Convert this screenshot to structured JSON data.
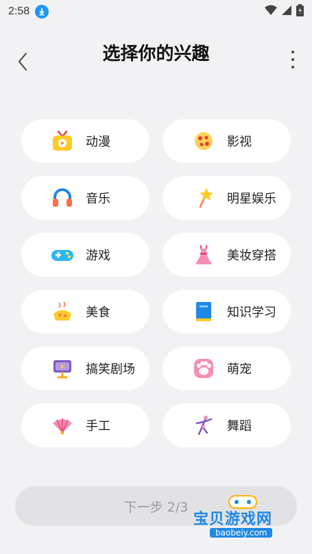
{
  "status_bar": {
    "time": "2:58"
  },
  "header": {
    "title": "选择你的兴趣"
  },
  "interests": [
    {
      "label": "动漫",
      "icon": "anime-tv-icon"
    },
    {
      "label": "影视",
      "icon": "film-pizza-icon"
    },
    {
      "label": "音乐",
      "icon": "headphones-icon"
    },
    {
      "label": "明星娱乐",
      "icon": "star-wand-icon"
    },
    {
      "label": "游戏",
      "icon": "gamepad-icon"
    },
    {
      "label": "美妆穿搭",
      "icon": "dress-icon"
    },
    {
      "label": "美食",
      "icon": "food-icon"
    },
    {
      "label": "知识学习",
      "icon": "book-icon"
    },
    {
      "label": "搞笑剧场",
      "icon": "video-screen-icon"
    },
    {
      "label": "萌宠",
      "icon": "paw-icon"
    },
    {
      "label": "手工",
      "icon": "fan-icon"
    },
    {
      "label": "舞蹈",
      "icon": "dancer-icon"
    }
  ],
  "footer": {
    "next_label": "下一步 2/3"
  },
  "watermark": {
    "title": "宝贝游戏网",
    "url": "baobeiy.com"
  }
}
